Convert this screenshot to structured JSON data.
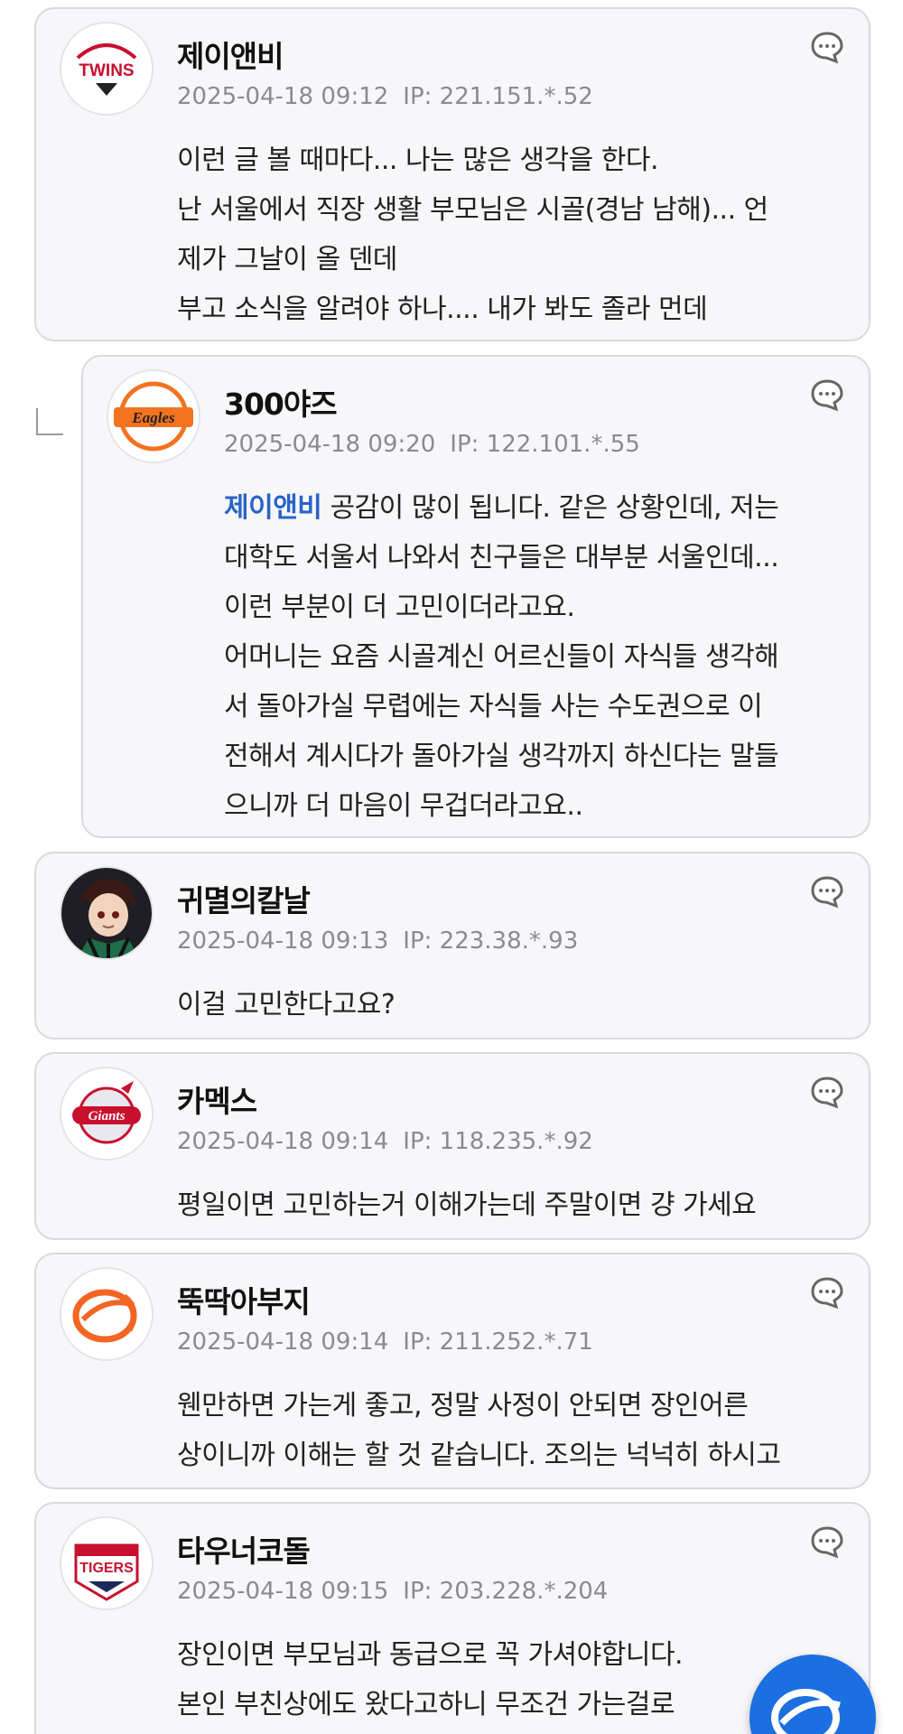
{
  "comments": [
    {
      "nickname": "제이앤비",
      "date": "2025-04-18 09:12",
      "ip": "IP: 221.151.*.52",
      "avatar_icon": "lg-twins-logo",
      "avatar_text": "TWINS",
      "lines": [
        "이런 글 볼 때마다... 나는 많은 생각을 한다.",
        "난 서울에서 직장 생활 부모님은 시골(경남 남해)... 언",
        "제가 그날이 올 덴데",
        "부고 소식을 알려야 하나.... 내가 봐도 졸라 먼데"
      ]
    },
    {
      "nickname": "300야즈",
      "date": "2025-04-18 09:20",
      "ip": "IP: 122.101.*.55",
      "avatar_icon": "hanwha-eagles-logo",
      "avatar_text": "Eagles",
      "mention": "제이앤비",
      "first_line_rest": " 공감이 많이 됩니다. 같은 상황인데, 저는",
      "lines": [
        "대학도 서울서 나와서 친구들은 대부분 서울인데...",
        "이런 부분이 더 고민이더라고요.",
        "어머니는 요즘 시골계신 어르신들이 자식들 생각해",
        "서 돌아가실 무렵에는 자식들 사는 수도권으로 이",
        "전해서 계시다가 돌아가실 생각까지 하신다는 말들",
        "으니까 더 마음이 무겁더라고요.."
      ]
    },
    {
      "nickname": "귀멸의칼날",
      "date": "2025-04-18 09:13",
      "ip": "IP: 223.38.*.93",
      "avatar_icon": "anime-character-avatar",
      "lines": [
        "이걸 고민한다고요?"
      ]
    },
    {
      "nickname": "카멕스",
      "date": "2025-04-18 09:14",
      "ip": "IP: 118.235.*.92",
      "avatar_icon": "lotte-giants-logo",
      "avatar_text": "Giants",
      "lines": [
        "평일이면 고민하는거 이해가는데 주말이면 걍 가세요"
      ]
    },
    {
      "nickname": "뚝딱아부지",
      "date": "2025-04-18 09:14",
      "ip": "IP: 211.252.*.71",
      "avatar_icon": "orange-baseball-logo",
      "lines": [
        "웬만하면 가는게 좋고, 정말 사정이 안되면 장인어른",
        "상이니까 이해는 할 것 같습니다. 조의는 넉넉히 하시고"
      ]
    },
    {
      "nickname": "타우너코돌",
      "date": "2025-04-18 09:15",
      "ip": "IP: 203.228.*.204",
      "avatar_icon": "kia-tigers-logo",
      "avatar_text": "TIGERS",
      "lines": [
        "장인이면 부모님과 동급으로 꼭 가셔야합니다.",
        "본인 부친상에도 왔다고하니 무조건 가는걸로"
      ]
    }
  ],
  "icons": {
    "comment": "comment-bubble-icon",
    "reply_indicator": "reply-arrow-icon",
    "fab": "write-comment-fab"
  },
  "colors": {
    "mention": "#2a63c7",
    "card_bg": "#f7f7f9",
    "meta": "#8a8a90",
    "fab": "#1b6fe0"
  }
}
